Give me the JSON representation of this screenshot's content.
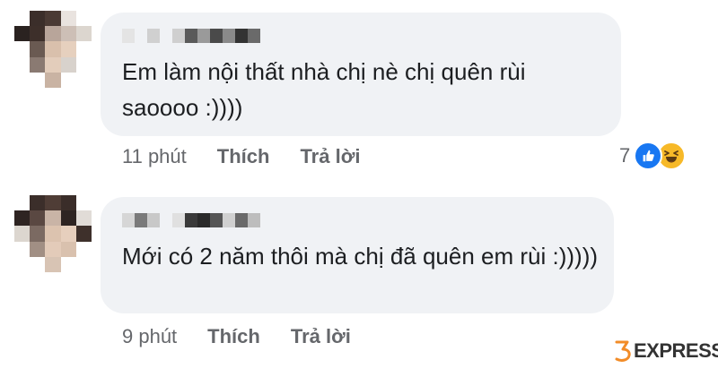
{
  "comments": [
    {
      "text": "Em làm nội thất nhà chị nè chị quên rùi saoooo :))))",
      "time": "11 phút",
      "like_label": "Thích",
      "reply_label": "Trả lời",
      "reaction_count": "7",
      "reactions": [
        "like-icon",
        "haha-icon"
      ]
    },
    {
      "text": "Mới có 2 năm thôi mà chị đã quên em rùi :)))))",
      "time": "9 phút",
      "like_label": "Thích",
      "reply_label": "Trả lời"
    }
  ],
  "watermark": {
    "brand_text": "EXPRESS",
    "logo_mark": "35"
  },
  "colors": {
    "bubble": "#f0f2f5",
    "text": "#1c1e21",
    "secondary_text": "#65676b",
    "like_blue": "#1877f2",
    "haha_yellow": "#f7b928",
    "watermark_orange": "#f28c28"
  }
}
